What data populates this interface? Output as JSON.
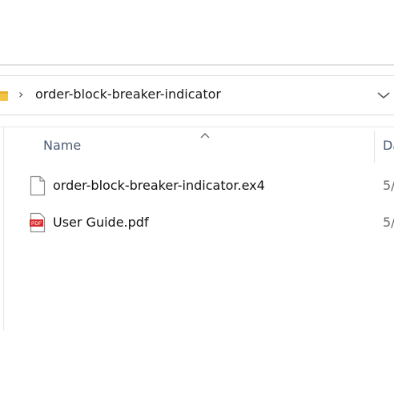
{
  "address_bar": {
    "path_segment": "order-block-breaker-indicator",
    "separator": "›",
    "folder_icon": "folder-icon",
    "history_icon": "chevron-down-icon"
  },
  "columns": {
    "name": "Name",
    "date": "Da",
    "sort": "ascending"
  },
  "files": [
    {
      "name": "order-block-breaker-indicator.ex4",
      "date": "5/",
      "icon": "generic-file-icon"
    },
    {
      "name": "User Guide.pdf",
      "date": "5/",
      "icon": "pdf-file-icon",
      "icon_label": "PDF"
    }
  ],
  "colors": {
    "folder": "#f3c343",
    "pdf_accent": "#d32f2f",
    "header_text": "#4b5a73"
  }
}
